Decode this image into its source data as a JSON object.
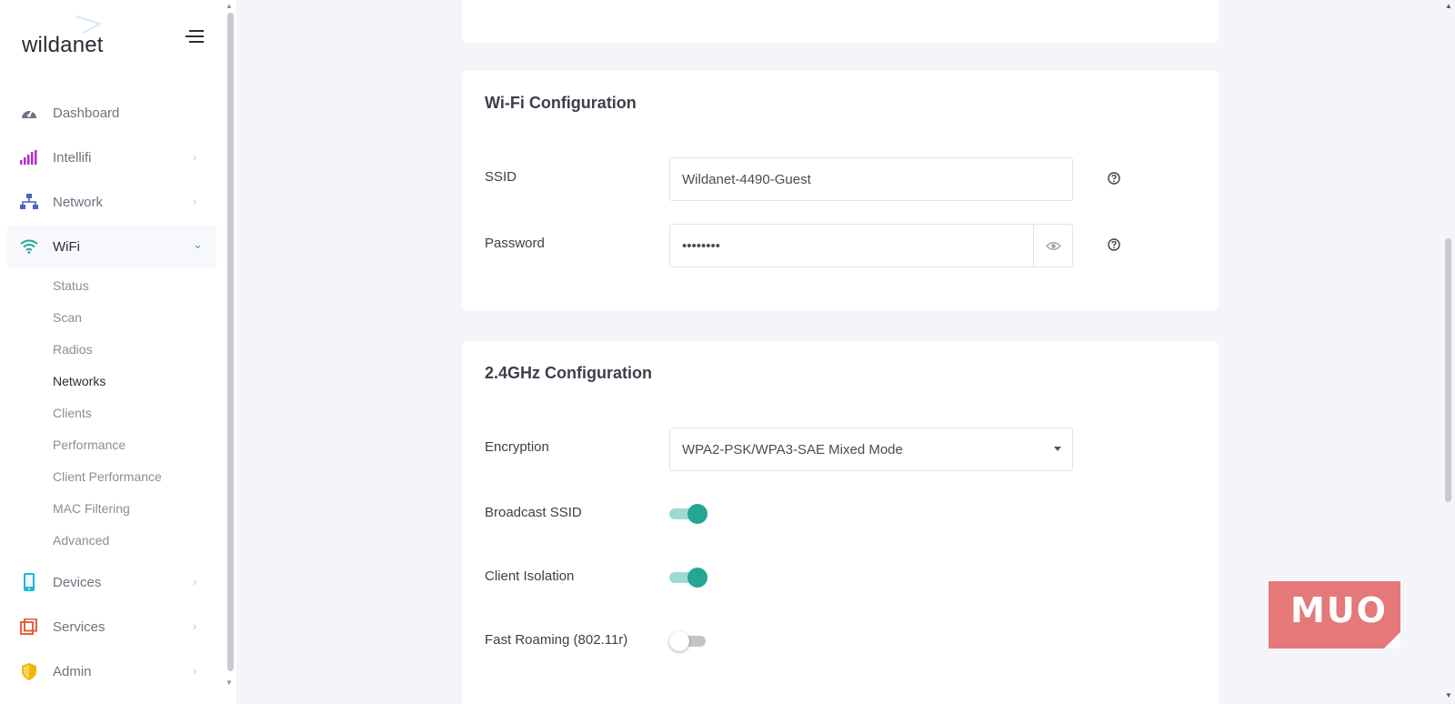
{
  "brand": {
    "logo_text": "wildanet"
  },
  "sidebar": {
    "items": [
      {
        "label": "Dashboard",
        "icon": "gauge-icon",
        "color": "#6f7280",
        "has_chevron": false
      },
      {
        "label": "Intellifi",
        "icon": "signal-bars-icon",
        "color": "#b12fc9",
        "has_chevron": true
      },
      {
        "label": "Network",
        "icon": "network-icon",
        "color": "#4a63c9",
        "has_chevron": true
      },
      {
        "label": "WiFi",
        "icon": "wifi-icon",
        "color": "#24a595",
        "has_chevron": true,
        "expanded": true
      },
      {
        "label": "Devices",
        "icon": "mobile-icon",
        "color": "#20b6d6",
        "has_chevron": true
      },
      {
        "label": "Services",
        "icon": "windows-icon",
        "color": "#e0623a",
        "has_chevron": true
      },
      {
        "label": "Admin",
        "icon": "shield-icon",
        "color": "#f2b705",
        "has_chevron": true
      }
    ],
    "wifi_subitems": [
      {
        "label": "Status"
      },
      {
        "label": "Scan"
      },
      {
        "label": "Radios"
      },
      {
        "label": "Networks",
        "active": true
      },
      {
        "label": "Clients"
      },
      {
        "label": "Performance"
      },
      {
        "label": "Client Performance"
      },
      {
        "label": "MAC Filtering"
      },
      {
        "label": "Advanced"
      }
    ]
  },
  "wifi_config": {
    "title": "Wi-Fi Configuration",
    "ssid_label": "SSID",
    "ssid_value": "Wildanet-4490-Guest",
    "password_label": "Password",
    "password_value": "••••••••"
  },
  "ghz_config": {
    "title": "2.4GHz Configuration",
    "encryption_label": "Encryption",
    "encryption_value": "WPA2-PSK/WPA3-SAE Mixed Mode",
    "broadcast_label": "Broadcast SSID",
    "broadcast_on": true,
    "isolation_label": "Client Isolation",
    "isolation_on": true,
    "roaming_label": "Fast Roaming (802.11r)",
    "roaming_on": false
  },
  "watermark": {
    "text": "MUO",
    "color": "#e36a6a"
  },
  "colors": {
    "accent": "#24a595",
    "background": "#f4f5fa"
  }
}
